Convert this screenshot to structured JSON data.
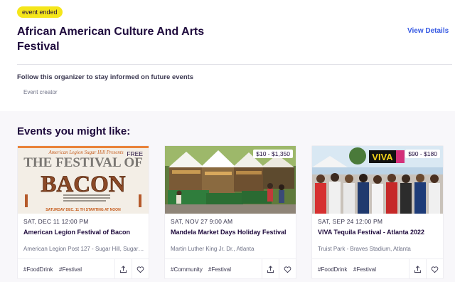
{
  "header": {
    "badge": "event ended",
    "title": "African American Culture And Arts Festival",
    "view_details": "View Details",
    "follow_text": "Follow this organizer to stay informed on future events",
    "creator_label": "Event creator"
  },
  "section": {
    "title": "Events you might like:"
  },
  "cards": [
    {
      "price": "FREE",
      "date": "SAT, DEC 11 12:00 PM",
      "title": "American Legion Festival of Bacon",
      "location": "American Legion Post 127 - Sugar Hill, Sugar Hill",
      "tags": [
        "#FoodDrink",
        "#Festival"
      ],
      "poster": {
        "top_line": "American Legion Sugar Hill Presents",
        "heading1": "THE FESTIVAL OF",
        "heading2": "BACON",
        "date_line": "SATURDAY DEC. 11 TH STARTING AT NOON"
      }
    },
    {
      "price": "$10 - $1,350",
      "date": "SAT, NOV 27 9:00 AM",
      "title": "Mandela Market Days Holiday Festival",
      "location": "Martin Luther King Jr. Dr., Atlanta",
      "tags": [
        "#Community",
        "#Festival"
      ]
    },
    {
      "price": "$90 - $180",
      "date": "SAT, SEP 24 12:00 PM",
      "title": "VIVA Tequila Festival - Atlanta 2022",
      "location": "Truist Park - Braves Stadium, Atlanta",
      "tags": [
        "#FoodDrink",
        "#Festival"
      ],
      "banner": "VIVA"
    }
  ],
  "colors": {
    "badge": "#f5e61a",
    "link": "#3659e3",
    "heading": "#1e0a3c",
    "section_bg": "#f8f7fa"
  },
  "icons": {
    "share": "share-icon",
    "like": "heart-icon"
  }
}
